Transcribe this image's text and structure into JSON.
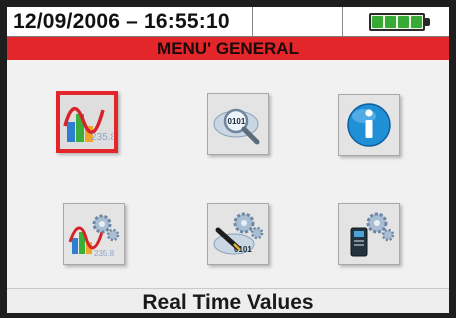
{
  "status_bar": {
    "datetime": "12/09/2006 – 16:55:10",
    "battery_level": 1.0
  },
  "header": {
    "title": "MENU' GENERAL"
  },
  "menu": {
    "items": [
      {
        "icon": "real-time-values-icon",
        "selected": true
      },
      {
        "icon": "search-data-icon",
        "selected": false
      },
      {
        "icon": "info-icon",
        "selected": false
      },
      {
        "icon": "analyzer-settings-icon",
        "selected": false
      },
      {
        "icon": "general-settings-icon",
        "selected": false
      },
      {
        "icon": "probe-settings-icon",
        "selected": false
      }
    ]
  },
  "footer": {
    "label": "Real Time Values"
  },
  "colors": {
    "accent": "#e3262a",
    "battery": "#37a935",
    "info_blue": "#1f8fd6"
  }
}
